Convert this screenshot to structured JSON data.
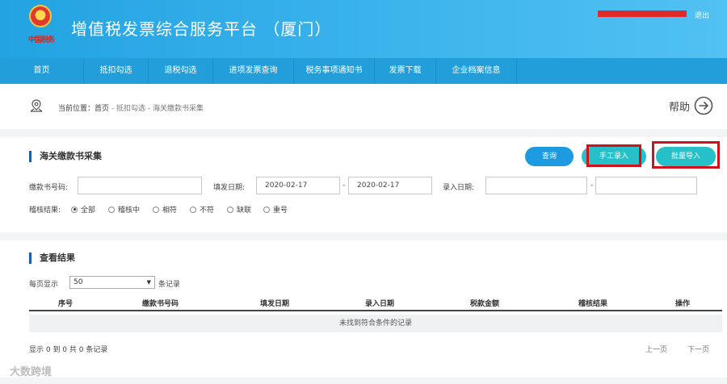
{
  "header": {
    "logo_text": "中国税务",
    "title": "增值税发票综合服务平台 （厦门）",
    "logout": "退出"
  },
  "nav": {
    "items": [
      "首页",
      "抵扣勾选",
      "退税勾选",
      "进项发票查询",
      "税务事项通知书",
      "发票下载",
      "企业档案信息"
    ]
  },
  "breadcrumb": {
    "prefix": "当前位置：",
    "home": "首页",
    "sep1": " - ",
    "level2": "抵扣勾选",
    "sep2": " - ",
    "current": "海关缴款书采集",
    "help": "帮助"
  },
  "form": {
    "title": "海关缴款书采集",
    "query_btn": "查询",
    "manual_btn": "手工录入",
    "batch_btn": "批量导入",
    "number_label": "缴款书号码:",
    "fill_date_label": "填发日期:",
    "fill_date_from": "2020-02-17",
    "fill_date_to": "2020-02-17",
    "dash": "-",
    "entry_date_label": "录入日期:",
    "audit_label": "稽核结果:",
    "radios": [
      "全部",
      "稽核中",
      "相符",
      "不符",
      "缺联",
      "重号"
    ],
    "selected_radio": "全部"
  },
  "results": {
    "title": "查看结果",
    "per_page_label": "每页显示",
    "per_page_value": "50",
    "records_suffix": "条记录",
    "columns": [
      "序号",
      "缴款书号码",
      "填发日期",
      "录入日期",
      "税款金额",
      "稽核结果",
      "操作"
    ],
    "empty_text": "未找到符合条件的记录",
    "summary": "显示 0 到 0 共 0 条记录",
    "prev": "上一页",
    "next": "下一页"
  },
  "watermark": "大数跨境",
  "colors": {
    "header_blue": "#2ba8e5",
    "nav_blue": "#229fdb",
    "button_blue": "#1e9ae0",
    "button_teal": "#26c0c9",
    "highlight_red": "#d0101a"
  }
}
